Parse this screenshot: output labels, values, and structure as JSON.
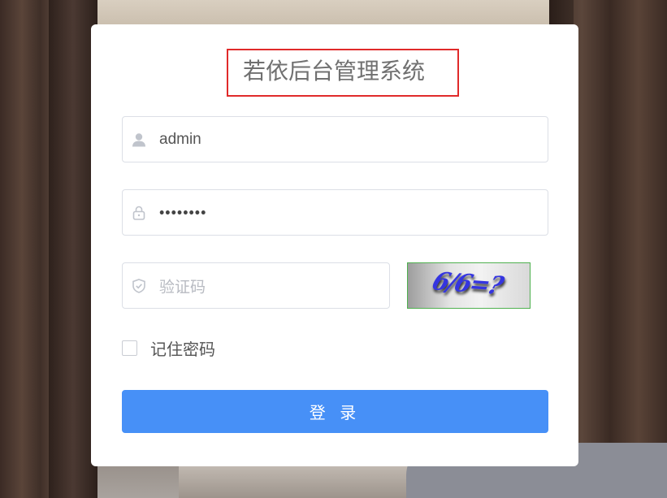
{
  "title": "若依后台管理系统",
  "username": {
    "value": "admin",
    "icon": "user-icon"
  },
  "password": {
    "masked_value": "••••••••",
    "icon": "lock-icon"
  },
  "captcha": {
    "placeholder": "验证码",
    "icon": "shield-icon",
    "image_text": "6/6=?"
  },
  "remember": {
    "label": "记住密码",
    "checked": false
  },
  "login_button": {
    "label": "登 录"
  },
  "colors": {
    "primary": "#4790f7",
    "title_highlight_border": "#e02a2a",
    "captcha_border": "#4fb04f"
  }
}
